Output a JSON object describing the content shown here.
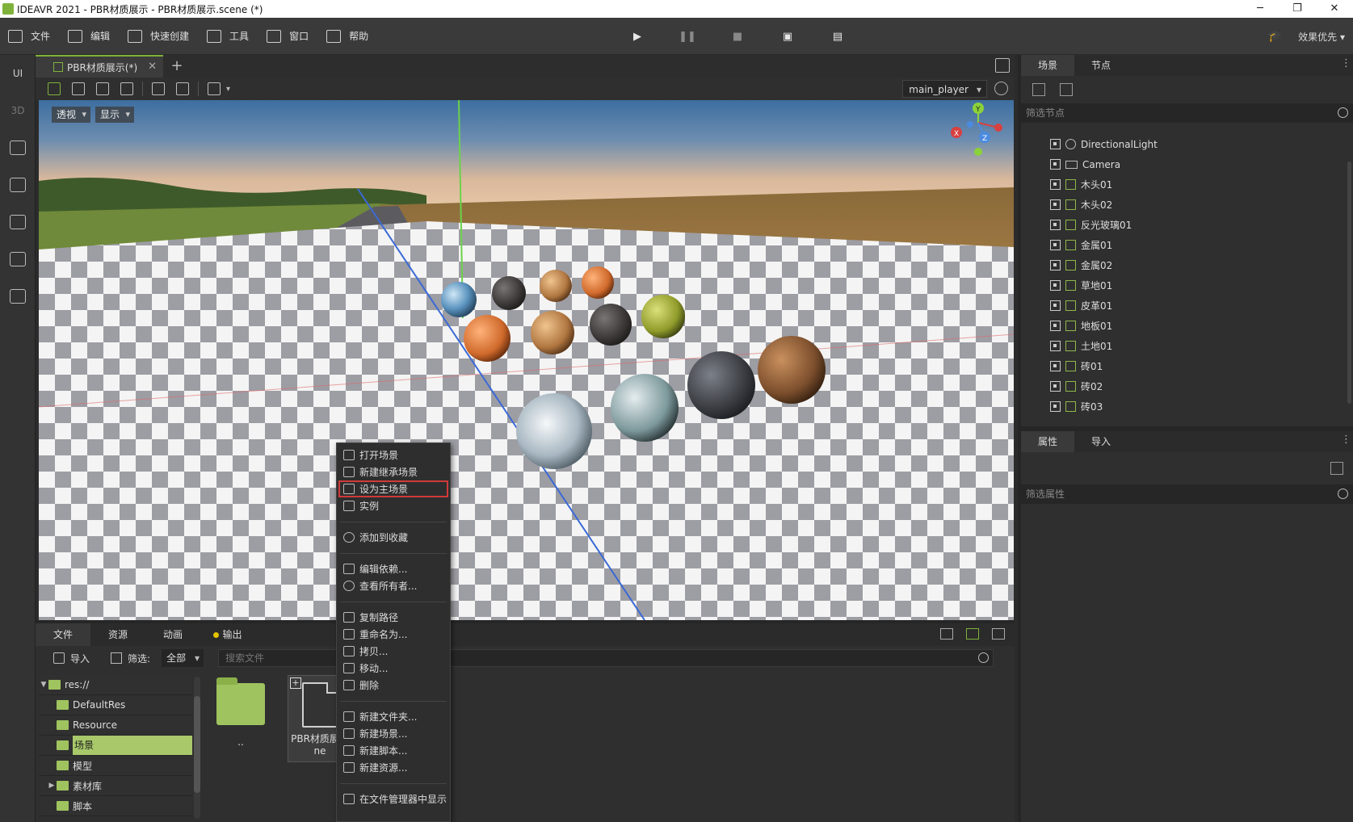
{
  "window": {
    "title": "IDEAVR 2021 - PBR材质展示 - PBR材质展示.scene (*)",
    "minimize": "─",
    "restore": "❐",
    "close": "✕"
  },
  "menubar": {
    "items": [
      {
        "label": "文件",
        "icon": "folder-icon"
      },
      {
        "label": "编辑",
        "icon": "crop-icon"
      },
      {
        "label": "快速创建",
        "icon": "edit-icon"
      },
      {
        "label": "工具",
        "icon": "toolbox-icon"
      },
      {
        "label": "窗口",
        "icon": "window-icon"
      },
      {
        "label": "帮助",
        "icon": "help-icon"
      }
    ],
    "play": "▶",
    "pause": "❚❚",
    "stop": "■",
    "quality_label": "效果优先"
  },
  "left_toolbar": {
    "ui_label": "UI",
    "three_d_label": "3D"
  },
  "document_tab": {
    "label": "PBR材质展示(*)",
    "close": "✕",
    "add": "+"
  },
  "viewport_toolbar": {
    "player_select": "main_player"
  },
  "viewport": {
    "perspective_label": "透视",
    "display_label": "显示",
    "gizmo_axes": [
      "X",
      "Y",
      "Z"
    ]
  },
  "bottom_panel": {
    "tabs": [
      "文件",
      "资源",
      "动画",
      "输出"
    ],
    "import_label": "导入",
    "filter_label": "筛选:",
    "filter_value": "全部",
    "search_placeholder": "搜索文件",
    "tree": [
      {
        "label": "res://",
        "arrow": "▼"
      },
      {
        "label": "DefaultRes"
      },
      {
        "label": "Resource"
      },
      {
        "label": "场景"
      },
      {
        "label": "模型"
      },
      {
        "label": "素材库",
        "arrow": "▶"
      },
      {
        "label": "脚本"
      }
    ],
    "files": [
      {
        "label": ".."
      },
      {
        "label": "PBR材质展示.scene",
        "line1": "PBR材质展示",
        "line2": "ne"
      }
    ]
  },
  "context_menu": {
    "items": [
      "打开场景",
      "新建继承场景",
      "设为主场景",
      "实例",
      "添加到收藏",
      "编辑依赖...",
      "查看所有者...",
      "复制路径",
      "重命名为...",
      "拷贝...",
      "移动...",
      "删除",
      "新建文件夹...",
      "新建场景...",
      "新建脚本...",
      "新建资源...",
      "在文件管理器中显示"
    ]
  },
  "scene_panel": {
    "tabs": [
      "场景",
      "节点"
    ],
    "more": "⋮",
    "search_placeholder": "筛选节点",
    "nodes": [
      {
        "label": "DirectionalLight",
        "type": "light"
      },
      {
        "label": "Camera",
        "type": "camera"
      },
      {
        "label": "木头01",
        "type": "mesh"
      },
      {
        "label": "木头02",
        "type": "mesh"
      },
      {
        "label": "反光玻璃01",
        "type": "mesh"
      },
      {
        "label": "金属01",
        "type": "mesh"
      },
      {
        "label": "金属02",
        "type": "mesh"
      },
      {
        "label": "草地01",
        "type": "mesh"
      },
      {
        "label": "皮革01",
        "type": "mesh"
      },
      {
        "label": "地板01",
        "type": "mesh"
      },
      {
        "label": "土地01",
        "type": "mesh"
      },
      {
        "label": "砖01",
        "type": "mesh"
      },
      {
        "label": "砖02",
        "type": "mesh"
      },
      {
        "label": "砖03",
        "type": "mesh"
      }
    ]
  },
  "props_panel": {
    "tabs": [
      "属性",
      "导入"
    ],
    "search_placeholder": "筛选属性"
  },
  "colors": {
    "accent": "#7fb23a",
    "selected_folder": "#a8c86a",
    "highlight_outline": "#d03a3a",
    "output_dot": "#e5c300"
  }
}
